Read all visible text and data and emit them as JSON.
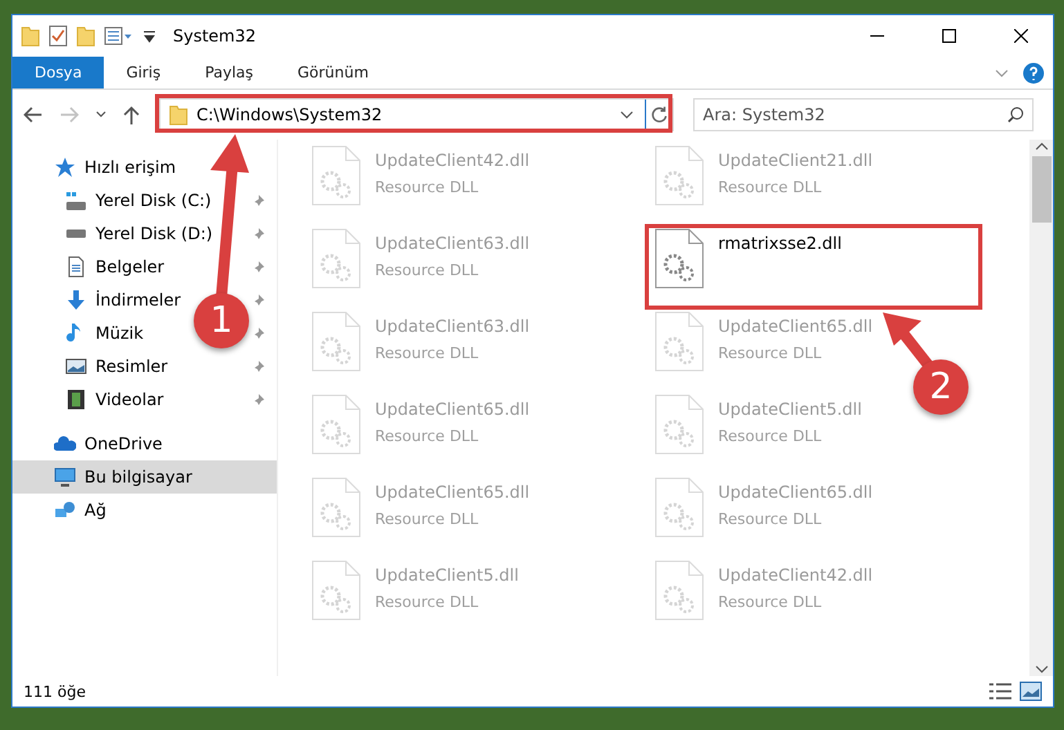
{
  "window": {
    "title": "System32"
  },
  "ribbon": {
    "tabs": [
      {
        "label": "Dosya",
        "selected": true
      },
      {
        "label": "Giriş",
        "selected": false
      },
      {
        "label": "Paylaş",
        "selected": false
      },
      {
        "label": "Görünüm",
        "selected": false
      }
    ]
  },
  "address_bar": {
    "path": "C:\\Windows\\System32",
    "forward_disabled": true
  },
  "search": {
    "placeholder": "Ara: System32"
  },
  "sidebar": {
    "items": [
      {
        "label": "Hızlı erişim",
        "kind": "star",
        "selected": false,
        "children": [
          {
            "label": "Yerel Disk (C:)",
            "kind": "systemdrive",
            "pinned": true,
            "selected": false
          },
          {
            "label": "Yerel Disk (D:)",
            "kind": "drive",
            "pinned": true,
            "selected": false
          },
          {
            "label": "Belgeler",
            "kind": "document",
            "pinned": true,
            "selected": false
          },
          {
            "label": "İndirmeler",
            "kind": "download",
            "pinned": true,
            "selected": false
          },
          {
            "label": "Müzik",
            "kind": "music",
            "pinned": true,
            "selected": false
          },
          {
            "label": "Resimler",
            "kind": "picture",
            "pinned": true,
            "selected": false
          },
          {
            "label": "Videolar",
            "kind": "video",
            "pinned": true,
            "selected": false
          }
        ]
      },
      {
        "label": "OneDrive",
        "kind": "cloud",
        "selected": false
      },
      {
        "label": "Bu bilgisayar",
        "kind": "computer",
        "selected": true
      },
      {
        "label": "Ağ",
        "kind": "network",
        "selected": false
      }
    ]
  },
  "files": [
    {
      "name": "UpdateClient42.dll",
      "type": "Resource DLL",
      "faded": true
    },
    {
      "name": "UpdateClient21.dll",
      "type": "Resource DLL",
      "faded": true
    },
    {
      "name": "UpdateClient63.dll",
      "type": "Resource DLL",
      "faded": true
    },
    {
      "name": "rmatrixsse2.dll",
      "faded": false
    },
    {
      "name": "UpdateClient63.dll",
      "type": "Resource DLL",
      "faded": true
    },
    {
      "name": "UpdateClient65.dll",
      "type": "Resource DLL",
      "faded": true
    },
    {
      "name": "UpdateClient65.dll",
      "type": "Resource DLL",
      "faded": true
    },
    {
      "name": "UpdateClient5.dll",
      "type": "Resource DLL",
      "faded": true
    },
    {
      "name": "UpdateClient65.dll",
      "type": "Resource DLL",
      "faded": true
    },
    {
      "name": "UpdateClient65.dll",
      "type": "Resource DLL",
      "faded": true
    },
    {
      "name": "UpdateClient5.dll",
      "type": "Resource DLL",
      "faded": true
    },
    {
      "name": "UpdateClient42.dll",
      "type": "Resource DLL",
      "faded": true
    }
  ],
  "status_bar": {
    "count": "111 öğe"
  },
  "annotations": [
    {
      "number": "1"
    },
    {
      "number": "2"
    }
  ]
}
